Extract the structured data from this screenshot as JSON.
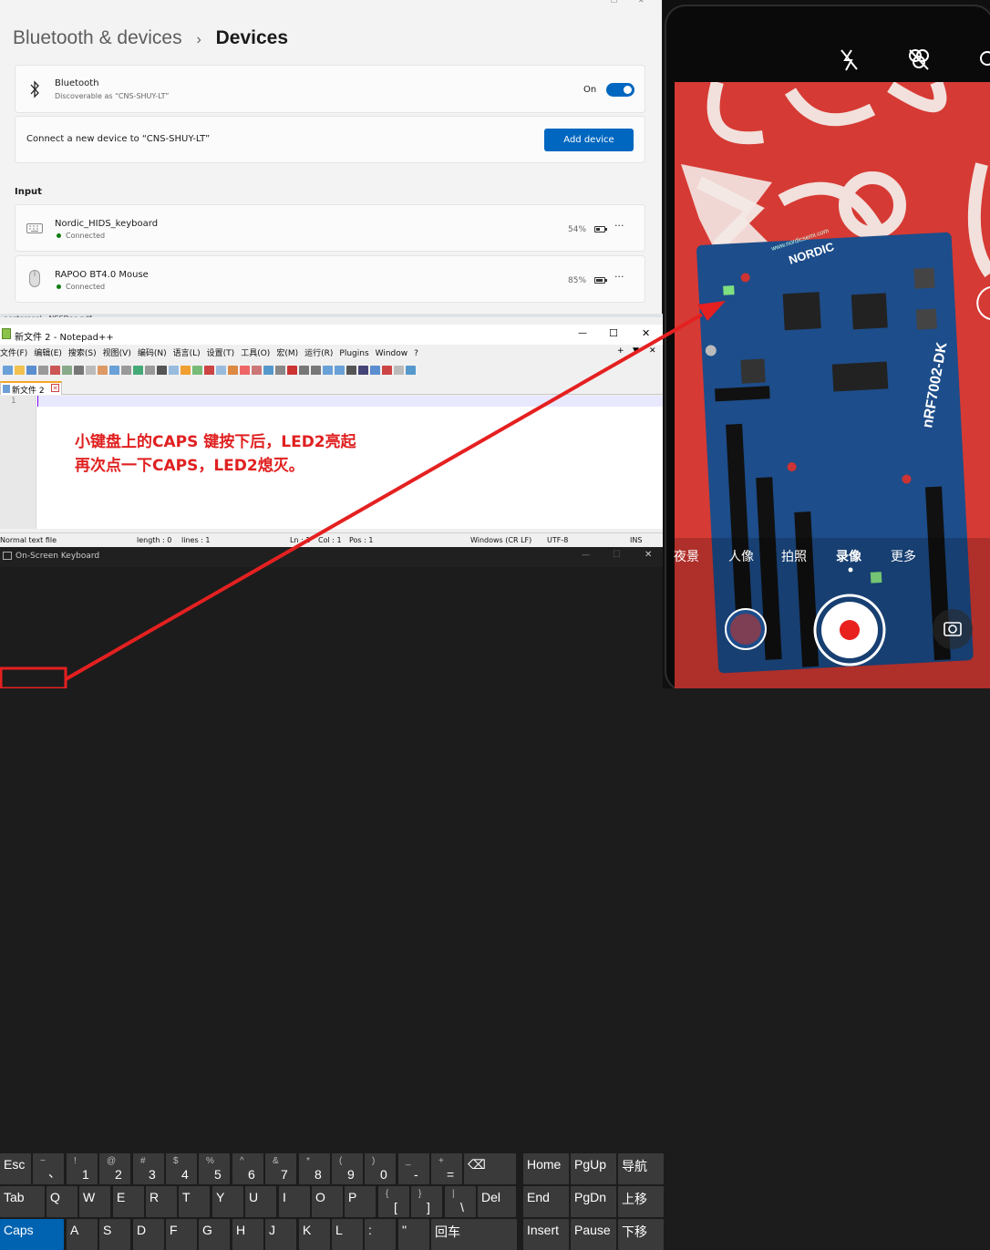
{
  "settings": {
    "breadcrumb_parent": "Bluetooth & devices",
    "breadcrumb_sep": "›",
    "breadcrumb_current": "Devices",
    "bluetooth": {
      "title": "Bluetooth",
      "subtitle": "Discoverable as “CNS-SHUY-LT”",
      "state": "On"
    },
    "connect": {
      "text": "Connect a new device to “CNS-SHUY-LT”",
      "button": "Add device"
    },
    "section_input": "Input",
    "devices": [
      {
        "name": "Nordic_HIDS_keyboard",
        "status": "Connected",
        "battery": "54%",
        "battery_level": 0.54,
        "more": "···"
      },
      {
        "name": "RAPOO BT4.0 Mouse",
        "status": "Connected",
        "battery": "85%",
        "battery_level": 0.85,
        "more": "···"
      }
    ]
  },
  "behind_strip": "postgresql · NESDoc.pdf",
  "notepad": {
    "title": "新文件 2 - Notepad++",
    "menu": [
      "文件(F)",
      "编辑(E)",
      "搜索(S)",
      "视图(V)",
      "编码(N)",
      "语言(L)",
      "设置(T)",
      "工具(O)",
      "宏(M)",
      "运行(R)",
      "Plugins",
      "Window",
      "?"
    ],
    "menu_right": [
      "+",
      "▼",
      "✕"
    ],
    "tab": "新文件 2",
    "line_number": "1",
    "annotation_line1": "小键盘上的CAPS 键按下后，LED2亮起",
    "annotation_line2": "再次点一下CAPS，LED2熄灭。",
    "status": {
      "type": "Normal text file",
      "length": "length : 0",
      "lines": "lines : 1",
      "ln": "Ln : 1",
      "col": "Col : 1",
      "pos": "Pos : 1",
      "eol": "Windows (CR LF)",
      "enc": "UTF-8",
      "ins": "INS"
    },
    "controls": {
      "min": "—",
      "max": "☐",
      "close": "✕"
    }
  },
  "osk": {
    "title": "On-Screen Keyboard",
    "controls": {
      "min": "—",
      "max": "☐",
      "close": "✕"
    },
    "row1": [
      {
        "main": "Esc"
      },
      {
        "shift": "~",
        "base": "、"
      },
      {
        "shift": "!",
        "base": "1"
      },
      {
        "shift": "@",
        "base": "2"
      },
      {
        "shift": "#",
        "base": "3"
      },
      {
        "shift": "$",
        "base": "4"
      },
      {
        "shift": "%",
        "base": "5"
      },
      {
        "shift": "^",
        "base": "6"
      },
      {
        "shift": "&",
        "base": "7"
      },
      {
        "shift": "*",
        "base": "8"
      },
      {
        "shift": "(",
        "base": "9"
      },
      {
        "shift": ")",
        "base": "0"
      },
      {
        "shift": "_",
        "base": "-"
      },
      {
        "shift": "+",
        "base": "="
      },
      {
        "main": "⌫"
      }
    ],
    "row2": [
      {
        "main": "Tab"
      },
      {
        "main": "Q"
      },
      {
        "main": "W"
      },
      {
        "main": "E"
      },
      {
        "main": "R"
      },
      {
        "main": "T"
      },
      {
        "main": "Y"
      },
      {
        "main": "U"
      },
      {
        "main": "I"
      },
      {
        "main": "O"
      },
      {
        "main": "P"
      },
      {
        "shift": "{",
        "base": "["
      },
      {
        "shift": "}",
        "base": "]"
      },
      {
        "shift": "|",
        "base": "\\"
      },
      {
        "main": "Del"
      }
    ],
    "row3": [
      {
        "main": "Caps"
      },
      {
        "main": "A"
      },
      {
        "main": "S"
      },
      {
        "main": "D"
      },
      {
        "main": "F"
      },
      {
        "main": "G"
      },
      {
        "main": "H"
      },
      {
        "main": "J"
      },
      {
        "main": "K"
      },
      {
        "main": "L"
      },
      {
        "main": ":"
      },
      {
        "main": "\""
      },
      {
        "main": "回车"
      }
    ],
    "nav": [
      [
        "Home",
        "PgUp",
        "导航"
      ],
      [
        "End",
        "PgDn",
        "上移"
      ],
      [
        "Insert",
        "Pause",
        "下移"
      ]
    ]
  },
  "phone": {
    "modes": [
      "夜景",
      "人像",
      "拍照",
      "录像",
      "更多"
    ],
    "active_mode": "录像",
    "board_label": "nRF7002-DK",
    "board_brand": "NORDIC",
    "board_url": "www.nordicsemi.com",
    "colors": {
      "background": "#d63a34",
      "board": "#1d4d8a",
      "record": "#e8201e"
    }
  },
  "colors": {
    "accent": "#0067c0",
    "annotation": "#e02020",
    "arrow": "#e52020"
  }
}
